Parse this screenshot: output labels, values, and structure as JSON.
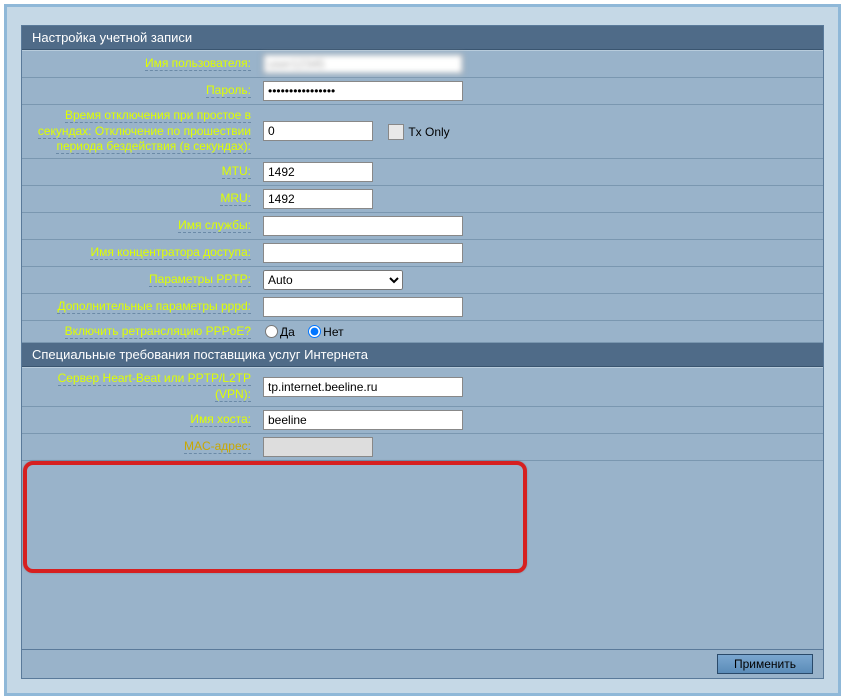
{
  "sections": {
    "account": {
      "header": "Настройка учетной записи",
      "rows": {
        "username": {
          "label": "Имя пользователя:",
          "value": "user12345"
        },
        "password": {
          "label": "Пароль:",
          "value": "••••••••••••••••"
        },
        "idle": {
          "label": "Время отключения при простое в секундах: Отключение по прошествии периода бездействия (в секундах):",
          "value": "0",
          "txonly": "Tx Only"
        },
        "mtu": {
          "label": "MTU:",
          "value": "1492"
        },
        "mru": {
          "label": "MRU:",
          "value": "1492"
        },
        "service": {
          "label": "Имя службы:",
          "value": ""
        },
        "ac": {
          "label": "Имя концентратора доступа:",
          "value": ""
        },
        "pptp": {
          "label": "Параметры PPTP:",
          "value": "Auto"
        },
        "pppd": {
          "label": "Дополнительные параметры pppd:",
          "value": ""
        },
        "relay": {
          "label": "Включить ретрансляцию PPPoE?",
          "yes": "Да",
          "no": "Нет"
        }
      }
    },
    "isp": {
      "header": "Специальные требования поставщика услуг Интернета",
      "rows": {
        "heartbeat": {
          "label": "Сервер Heart-Beat или PPTP/L2TP (VPN):",
          "value": "tp.internet.beeline.ru"
        },
        "hostname": {
          "label": "Имя хоста:",
          "value": "beeline"
        },
        "mac": {
          "label": "MAC-адрес:",
          "value": ""
        }
      }
    }
  },
  "footer": {
    "apply": "Применить"
  }
}
